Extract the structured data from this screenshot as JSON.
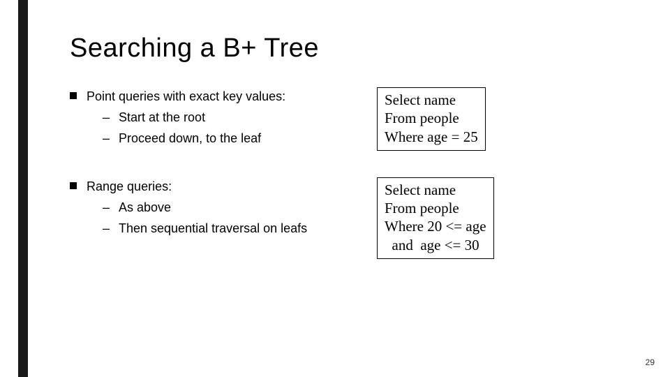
{
  "title": "Searching a B+ Tree",
  "sections": [
    {
      "heading": "Point queries with exact key values:",
      "items": [
        "Start at the root",
        "Proceed down, to the leaf"
      ],
      "sql": "Select name\nFrom people\nWhere age = 25"
    },
    {
      "heading": "Range queries:",
      "items": [
        "As above",
        "Then sequential traversal on leafs"
      ],
      "sql": "Select name\nFrom people\nWhere 20 <= age\n  and  age <= 30"
    }
  ],
  "page_number": "29"
}
